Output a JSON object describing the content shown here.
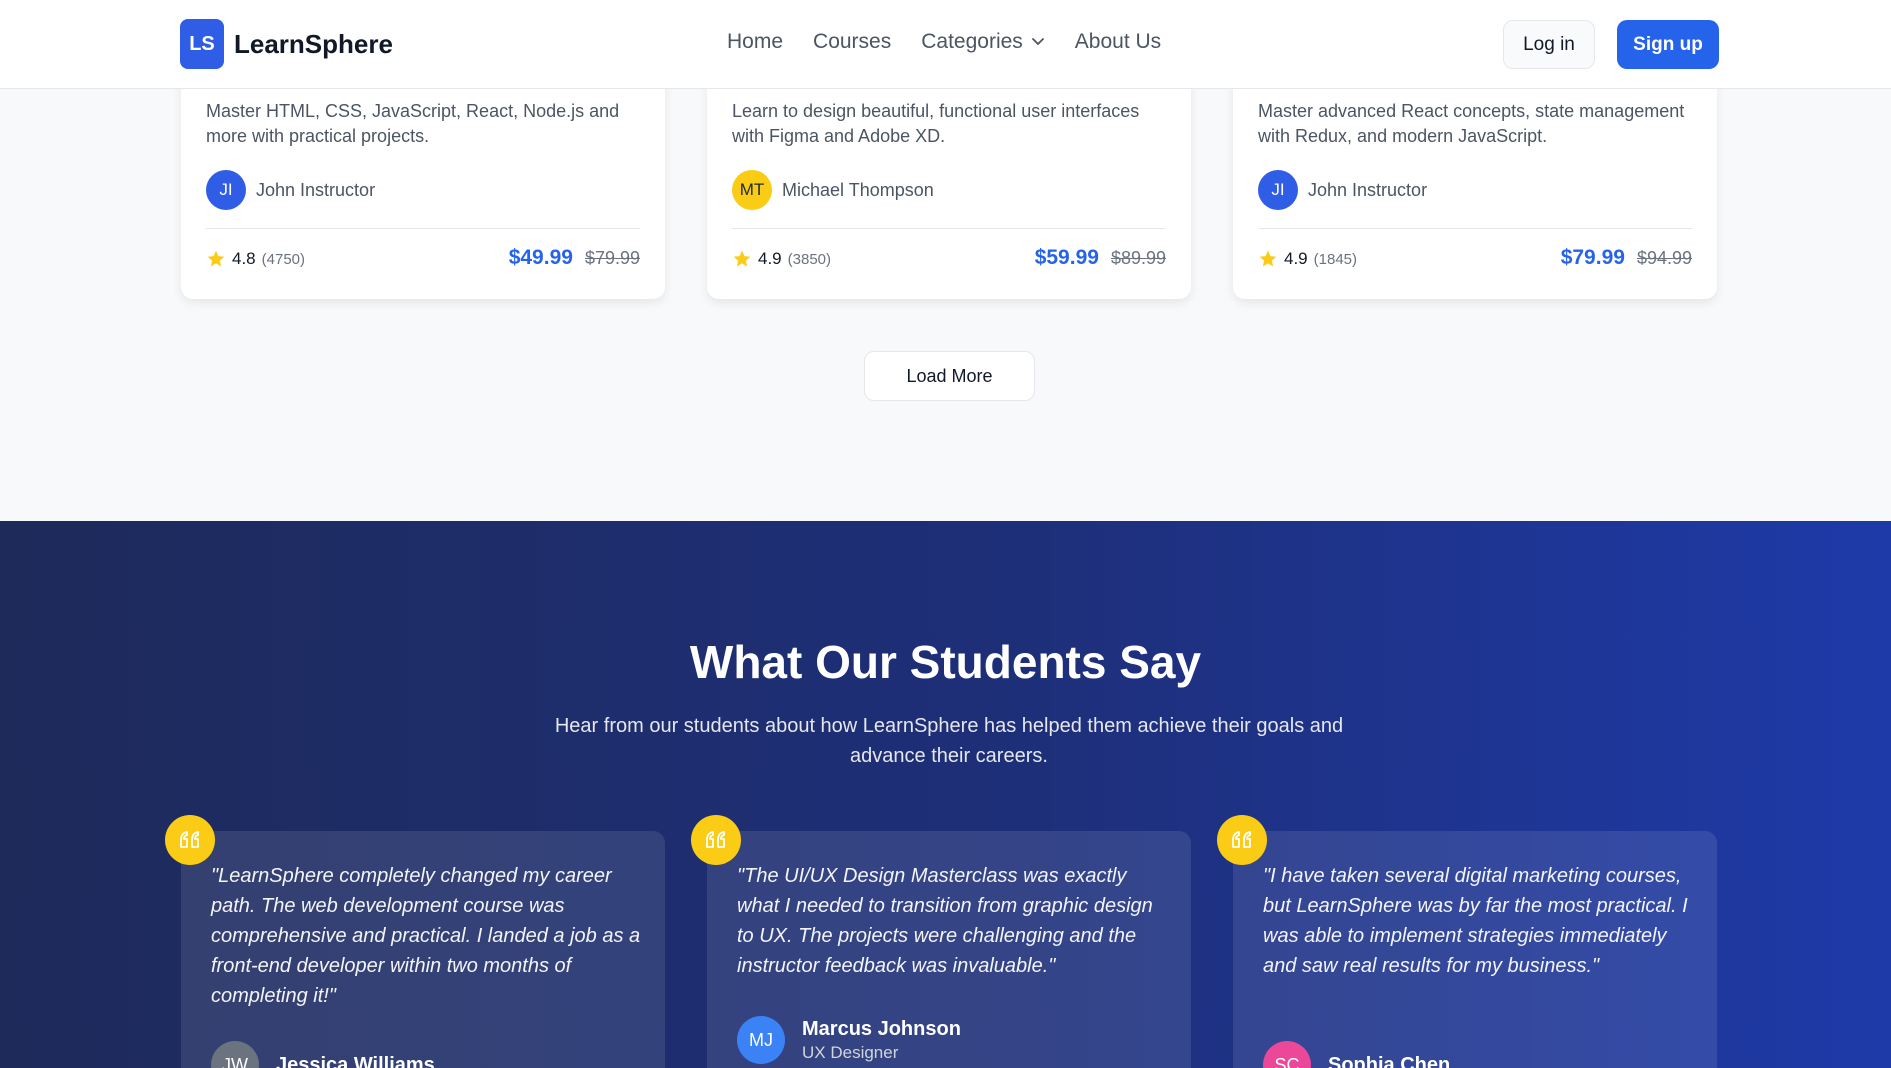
{
  "header": {
    "logo_badge": "LS",
    "logo_text": "LearnSphere",
    "nav": [
      "Home",
      "Courses",
      "Categories",
      "About Us"
    ],
    "login_label": "Log in",
    "signup_label": "Sign up"
  },
  "courses": [
    {
      "description": "Master HTML, CSS, JavaScript, React, Node.js and more with practical projects.",
      "instructor_initials": "JI",
      "instructor": "John Instructor",
      "rating": "4.8",
      "reviews": "(4750)",
      "price": "$49.99",
      "old_price": "$79.99"
    },
    {
      "description": "Learn to design beautiful, functional user interfaces with Figma and Adobe XD.",
      "instructor_initials": "MT",
      "instructor": "Michael Thompson",
      "rating": "4.9",
      "reviews": "(3850)",
      "price": "$59.99",
      "old_price": "$89.99"
    },
    {
      "description": "Master advanced React concepts, state management with Redux, and modern JavaScript.",
      "instructor_initials": "JI",
      "instructor": "John Instructor",
      "rating": "4.9",
      "reviews": "(1845)",
      "price": "$79.99",
      "old_price": "$94.99"
    }
  ],
  "load_more_label": "Load More",
  "testimonials": {
    "title": "What Our Students Say",
    "subtitle": "Hear from our students about how LearnSphere has helped them achieve their goals and advance their careers.",
    "items": [
      {
        "quote": "\"LearnSphere completely changed my career path. The web development course was comprehensive and practical. I landed a job as a front-end developer within two months of completing it!\"",
        "name": "Jessica Williams",
        "initials": "JW",
        "role": ""
      },
      {
        "quote": "\"The UI/UX Design Masterclass was exactly what I needed to transition from graphic design to UX. The projects were challenging and the instructor feedback was invaluable.\"",
        "name": "Marcus Johnson",
        "initials": "MJ",
        "role": "UX Designer"
      },
      {
        "quote": "\"I have taken several digital marketing courses, but LearnSphere was by far the most practical. I was able to implement strategies immediately and saw real results for my business.\"",
        "name": "Sophia Chen",
        "initials": "SC",
        "role": ""
      }
    ]
  },
  "colors": {
    "brand": "#2563eb",
    "star": "#facc15",
    "instructor_blue": "#2f5de6",
    "instructor_yellow": "#facc15"
  }
}
